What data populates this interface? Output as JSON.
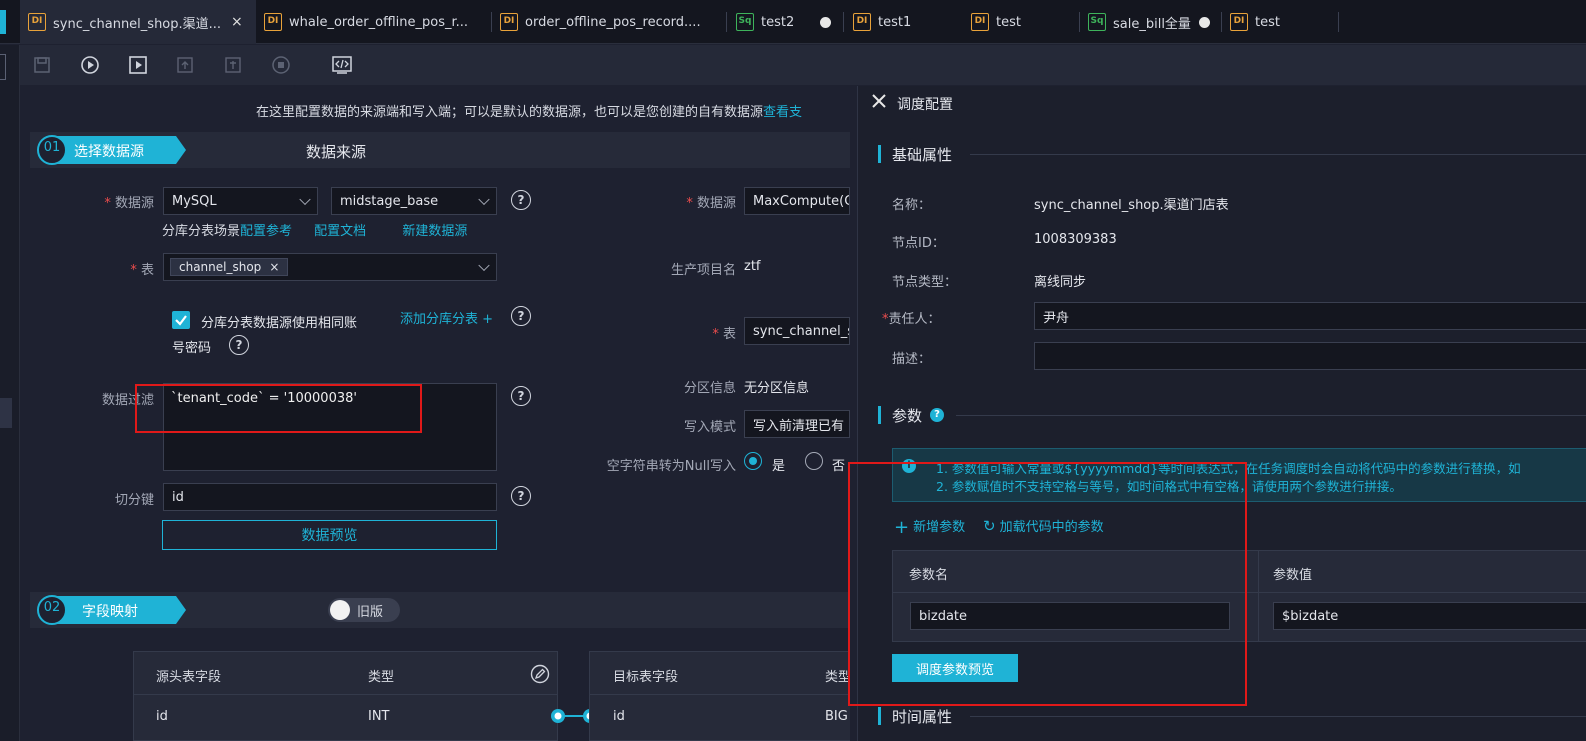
{
  "tabs": [
    {
      "label": "sync_channel_shop.渠道...",
      "icon": "DI"
    },
    {
      "label": "whale_order_offline_pos_r...",
      "icon": "DI"
    },
    {
      "label": "order_offline_pos_record....",
      "icon": "DI"
    },
    {
      "label": "test2",
      "icon": "Sq"
    },
    {
      "label": "test1",
      "icon": "DI"
    },
    {
      "label": "test",
      "icon": "DI"
    },
    {
      "label": "sale_bill全量",
      "icon": "Sq"
    },
    {
      "label": "test",
      "icon": "DI"
    }
  ],
  "tab_close": "×",
  "main": {
    "intro_text": "在这里配置数据的来源端和写入端；可以是默认的数据源，也可以是您创建的自有数据源",
    "intro_link": "查看支",
    "step1": {
      "num": "01",
      "label": "选择数据源",
      "section_title": "数据来源"
    },
    "source": {
      "datasource_label": "数据源",
      "datasource_type": "MySQL",
      "datasource_name": "midstage_base",
      "links": [
        "分库分表场景",
        "配置参考",
        "配置文档",
        "新建数据源"
      ],
      "table_label": "表",
      "table_tag": "channel_shop",
      "checkbox_label_1": "分库分表数据源使用相同账",
      "checkbox_label_2": "号密码",
      "add_shard_link": "添加分库分表 +",
      "filter_label": "数据过滤",
      "filter_value": "`tenant_code` = '10000038'",
      "split_label": "切分键",
      "split_value": "id",
      "preview_button": "数据预览"
    },
    "target": {
      "datasource_label": "数据源",
      "datasource_value": "MaxCompute(C",
      "project_label": "生产项目名",
      "project_value": "ztf",
      "table_label": "表",
      "table_value": "sync_channel_s",
      "partition_label": "分区信息",
      "partition_value": "无分区信息",
      "write_mode_label": "写入模式",
      "write_mode_value": "写入前清理已有",
      "null_label": "空字符串转为Null写入",
      "null_yes": "是",
      "null_no": "否"
    },
    "step2": {
      "num": "02",
      "label": "字段映射",
      "toggle_label": "旧版"
    },
    "mapping": {
      "src_headers": [
        "源头表字段",
        "类型"
      ],
      "src_row": [
        "id",
        "INT"
      ],
      "dst_headers": [
        "目标表字段",
        "类型"
      ],
      "dst_row": [
        "id",
        "BIG"
      ]
    }
  },
  "panel": {
    "title": "调度配置",
    "basic": {
      "title": "基础属性",
      "name_label": "名称：",
      "name_value": "sync_channel_shop.渠道门店表",
      "node_id_label": "节点ID：",
      "node_id_value": "1008309383",
      "node_type_label": "节点类型：",
      "node_type_value": "离线同步",
      "owner_label": "责任人：",
      "owner_value": "尹舟",
      "desc_label": "描述："
    },
    "params": {
      "title": "参数",
      "help_icon": "?",
      "tip_line1": "1. 参数值可输入常量或${yyyymmdd}等时间表达式，在任务调度时会自动将代码中的参数进行替换，如",
      "tip_line2": "2. 参数赋值时不支持空格与等号，如时间格式中有空格，请使用两个参数进行拼接。",
      "add_param": "新增参数",
      "load_param": "加载代码中的参数",
      "col_name": "参数名",
      "col_value": "参数值",
      "row_name": "bizdate",
      "row_value": "$bizdate",
      "preview_button": "调度参数预览"
    },
    "time_title": "时间属性"
  },
  "colors": {
    "accent": "#1fb3d6",
    "highlight": "#e01919",
    "di": "#e8a23a",
    "sq": "#3eb35b"
  }
}
